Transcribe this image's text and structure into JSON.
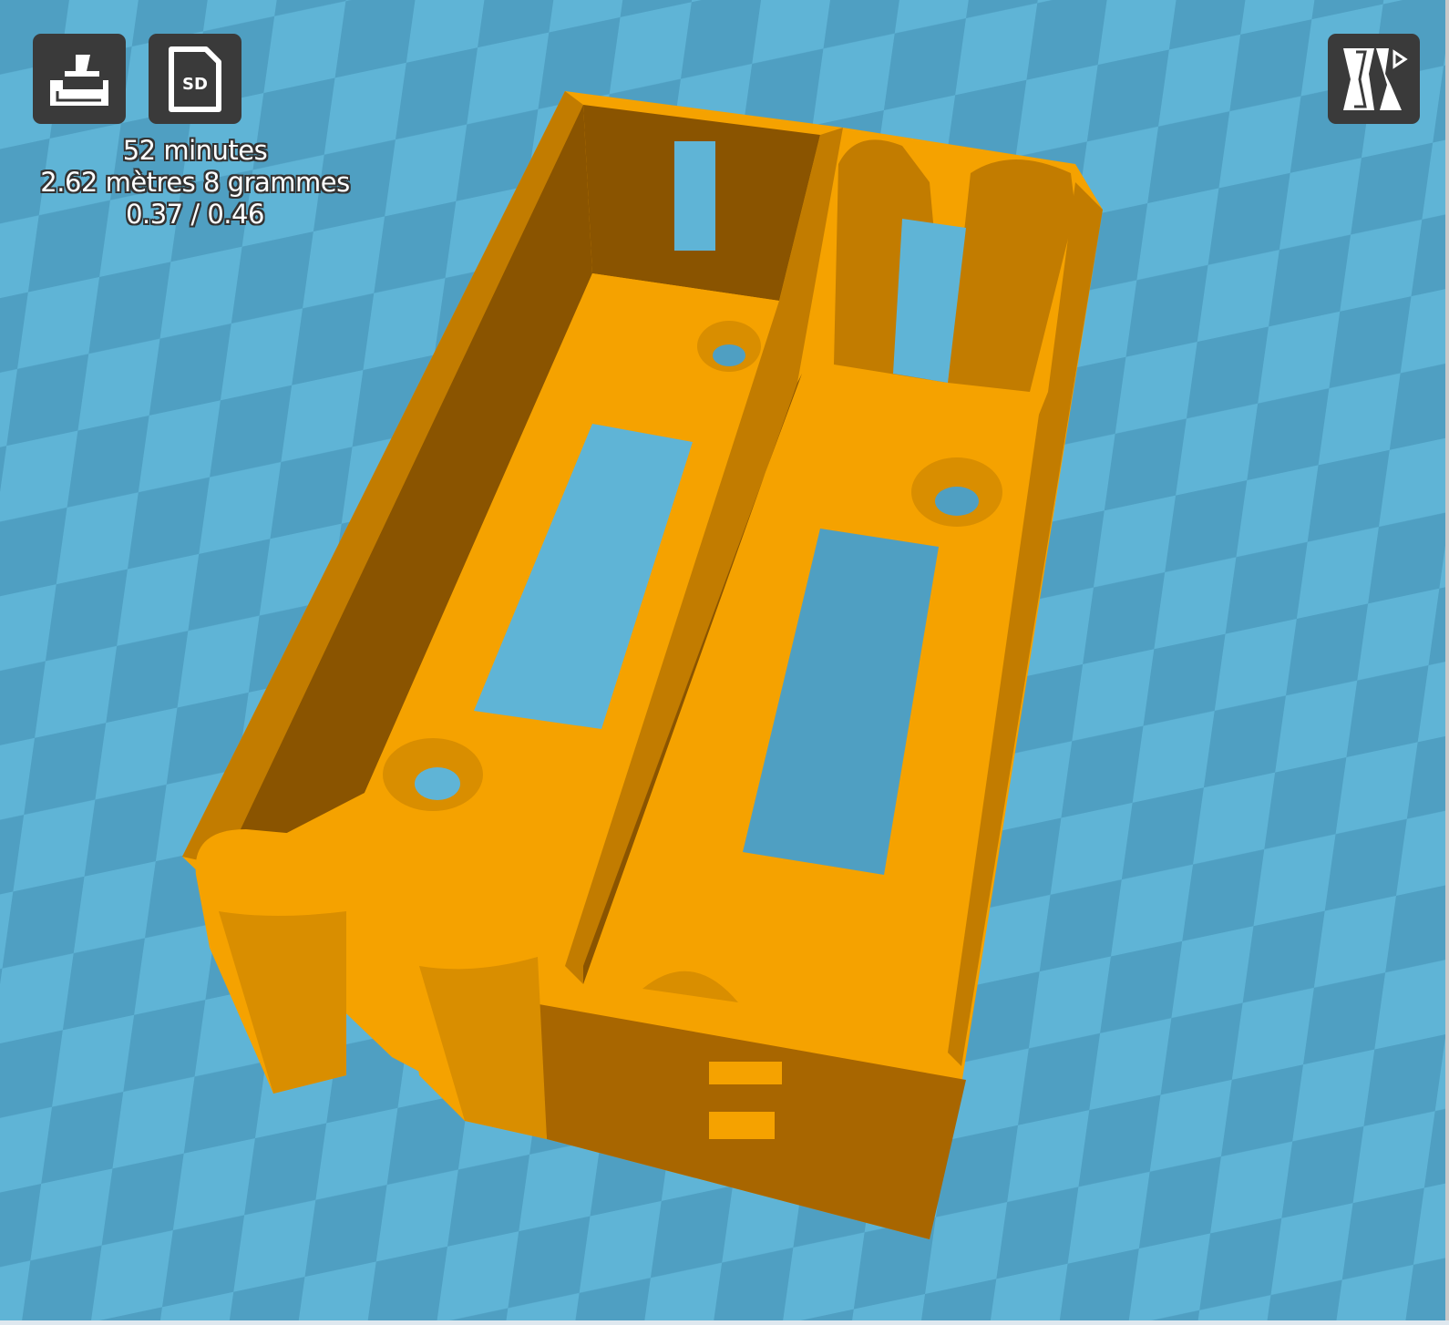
{
  "toolbar": {
    "print_icon": "printer-layflat-icon",
    "sd_label": "SD",
    "sd_icon": "sd-card-icon",
    "view_icon": "view-mode-icon"
  },
  "stats": {
    "time": "52 minutes",
    "material": "2.62 mètres 8 grammes",
    "cost": "0.37 / 0.46"
  },
  "colors": {
    "build_plate_light": "#5fb4d6",
    "build_plate_dark": "#4f9fc2",
    "model": "#f5a200",
    "model_shadow": "#c27c00",
    "model_dark": "#8a5400",
    "button_bg": "#3a3a3a"
  }
}
